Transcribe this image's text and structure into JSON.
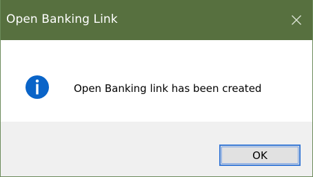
{
  "window": {
    "title": "Open Banking Link",
    "close_icon": "close-icon",
    "titlebar_color": "#57703f"
  },
  "message": {
    "icon": "info-icon",
    "icon_color": "#0a64c8",
    "text": "Open Banking link has been created"
  },
  "buttons": {
    "ok_label": "OK",
    "ok_border_color": "#3a7ad6"
  }
}
